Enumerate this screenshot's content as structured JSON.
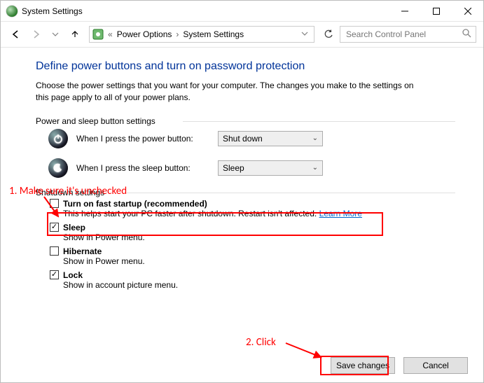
{
  "window": {
    "title": "System Settings"
  },
  "nav": {
    "breadcrumb1": "Power Options",
    "breadcrumb2": "System Settings",
    "search_placeholder": "Search Control Panel"
  },
  "page": {
    "title": "Define power buttons and turn on password protection",
    "description": "Choose the power settings that you want for your computer. The changes you make to the settings on this page apply to all of your power plans.",
    "section1_head": "Power and sleep button settings",
    "power_label": "When I press the power button:",
    "power_value": "Shut down",
    "sleep_label": "When I press the sleep button:",
    "sleep_value": "Sleep",
    "section2_head": "Shutdown settings",
    "items": [
      {
        "label": "Turn on fast startup (recommended)",
        "desc": "This helps start your PC faster after shutdown. Restart isn't affected. ",
        "learn": "Learn More",
        "checked": false,
        "bold": true
      },
      {
        "label": "Sleep",
        "desc": "Show in Power menu.",
        "checked": true,
        "bold": true
      },
      {
        "label": "Hibernate",
        "desc": "Show in Power menu.",
        "checked": false,
        "bold": true
      },
      {
        "label": "Lock",
        "desc": "Show in account picture menu.",
        "checked": true,
        "bold": true
      }
    ]
  },
  "footer": {
    "save": "Save changes",
    "cancel": "Cancel"
  },
  "annotations": {
    "a1": "1. Make sure it's unchecked",
    "a2": "2. Click"
  }
}
